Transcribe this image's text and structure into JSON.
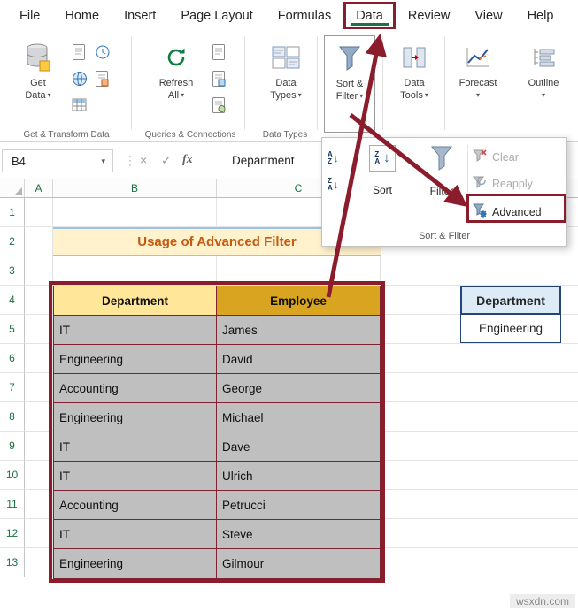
{
  "colors": {
    "annotation_red": "#8B1C2C",
    "excel_green": "#1E7145",
    "title_text": "#C55A11",
    "title_bg": "#FFF2CC",
    "dept_header_bg": "#FFE699",
    "emp_header_bg": "#D9A521",
    "data_cell_bg": "#BFBFBF",
    "criteria_header_bg": "#DDEBF7",
    "criteria_border": "#24447B"
  },
  "glyphs": {
    "chevron": "▾",
    "cancel": "×",
    "check": "✓",
    "dots": "⋮",
    "arrow_down": "↓",
    "letter_a": "A",
    "letter_z": "Z"
  },
  "menubar": {
    "items": [
      "File",
      "Home",
      "Insert",
      "Page Layout",
      "Formulas",
      "Data",
      "Review",
      "View",
      "Help"
    ]
  },
  "ribbon": {
    "get_data": [
      "Get",
      "Data"
    ],
    "refresh_all": [
      "Refresh",
      "All"
    ],
    "data_types": [
      "Data",
      "Types"
    ],
    "sort_filter": [
      "Sort &",
      "Filter"
    ],
    "data_tools": [
      "Data",
      "Tools"
    ],
    "forecast": "Forecast",
    "outline": "Outline",
    "group_labels": [
      "Get & Transform Data",
      "Queries & Connections",
      "Data Types"
    ]
  },
  "formula_bar": {
    "name_box": "B4",
    "fx_label": "fx",
    "value": "Department"
  },
  "dropdown": {
    "sort": "Sort",
    "filter": "Filter",
    "clear": "Clear",
    "reapply": "Reapply",
    "advanced": "Advanced",
    "group": "Sort & Filter"
  },
  "grid": {
    "column_headers": [
      "A",
      "B",
      "C"
    ],
    "row_numbers": [
      "1",
      "2",
      "3",
      "4",
      "5",
      "6",
      "7",
      "8",
      "9",
      "10",
      "11",
      "12",
      "13"
    ],
    "title": "Usage of Advanced Filter",
    "table": {
      "headers": [
        "Department",
        "Employee"
      ],
      "rows": [
        [
          "IT",
          "James"
        ],
        [
          "Engineering",
          "David"
        ],
        [
          "Accounting",
          "George"
        ],
        [
          "Engineering",
          "Michael"
        ],
        [
          "IT",
          "Dave"
        ],
        [
          "IT",
          "Ulrich"
        ],
        [
          "Accounting",
          "Petrucci"
        ],
        [
          "IT",
          "Steve"
        ],
        [
          "Engineering",
          "Gilmour"
        ]
      ]
    },
    "criteria": {
      "header": "Department",
      "value": "Engineering"
    }
  },
  "watermark": "wsxdn.com"
}
